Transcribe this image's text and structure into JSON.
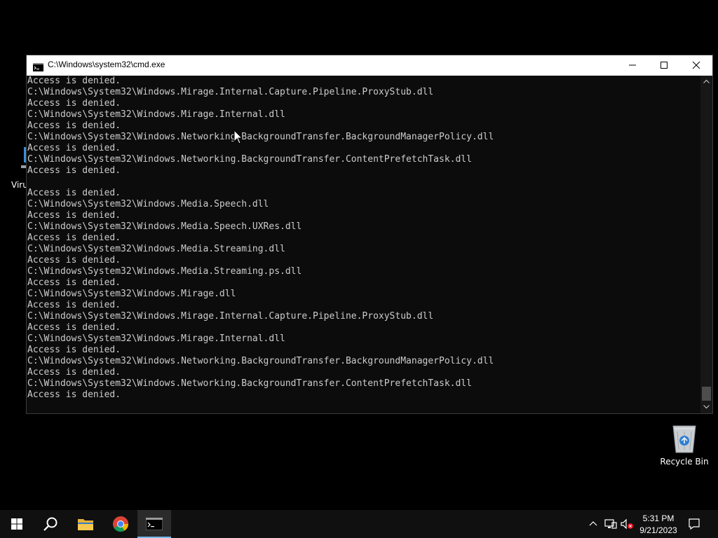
{
  "window": {
    "title": "C:\\Windows\\system32\\cmd.exe"
  },
  "console": {
    "lines": [
      "Access is denied.",
      "C:\\Windows\\System32\\Windows.Mirage.Internal.Capture.Pipeline.ProxyStub.dll",
      "Access is denied.",
      "C:\\Windows\\System32\\Windows.Mirage.Internal.dll",
      "Access is denied.",
      "C:\\Windows\\System32\\Windows.Networking.BackgroundTransfer.BackgroundManagerPolicy.dll",
      "Access is denied.",
      "C:\\Windows\\System32\\Windows.Networking.BackgroundTransfer.ContentPrefetchTask.dll",
      "Access is denied.",
      "",
      "Access is denied.",
      "C:\\Windows\\System32\\Windows.Media.Speech.dll",
      "Access is denied.",
      "C:\\Windows\\System32\\Windows.Media.Speech.UXRes.dll",
      "Access is denied.",
      "C:\\Windows\\System32\\Windows.Media.Streaming.dll",
      "Access is denied.",
      "C:\\Windows\\System32\\Windows.Media.Streaming.ps.dll",
      "Access is denied.",
      "C:\\Windows\\System32\\Windows.Mirage.dll",
      "Access is denied.",
      "C:\\Windows\\System32\\Windows.Mirage.Internal.Capture.Pipeline.ProxyStub.dll",
      "Access is denied.",
      "C:\\Windows\\System32\\Windows.Mirage.Internal.dll",
      "Access is denied.",
      "C:\\Windows\\System32\\Windows.Networking.BackgroundTransfer.BackgroundManagerPolicy.dll",
      "Access is denied.",
      "C:\\Windows\\System32\\Windows.Networking.BackgroundTransfer.ContentPrefetchTask.dll",
      "Access is denied."
    ]
  },
  "desktop": {
    "icons": [
      {
        "label": "Viru",
        "icon": "virus-shortcut-icon"
      },
      {
        "label": "Recycle Bin",
        "icon": "recycle-bin-icon"
      }
    ]
  },
  "taskbar": {
    "clock_time": "5:31 PM",
    "clock_date": "9/21/2023",
    "pinned": [
      "start",
      "search",
      "file-explorer",
      "chrome",
      "cmd"
    ]
  },
  "colors": {
    "desktop": "#000000",
    "console_bg": "#0c0c0c",
    "console_text": "#cccccc",
    "taskbar": "#101010",
    "accent": "#76b9ed"
  }
}
